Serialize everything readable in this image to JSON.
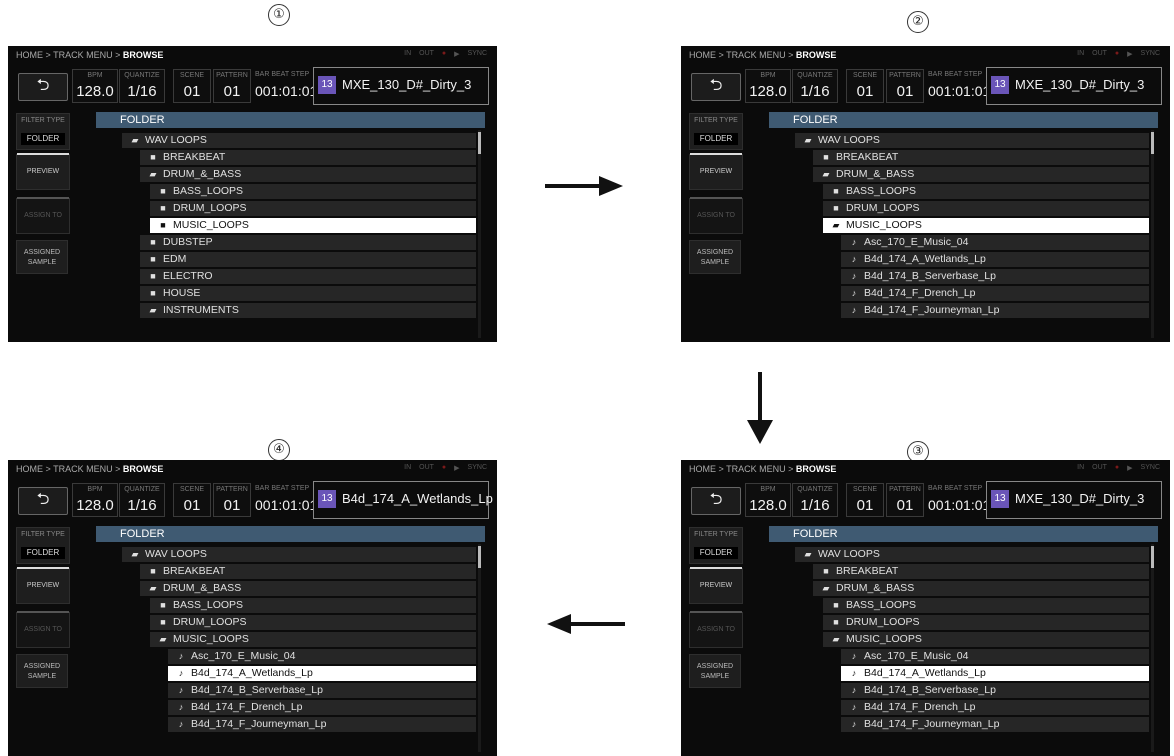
{
  "steps": {
    "s1": "①",
    "s2": "②",
    "s3": "③",
    "s4": "④"
  },
  "colors": {
    "folder_header": "#3f5a72",
    "track_num_bg": "#6a55b8",
    "screen_bg": "#0b0b0b",
    "selected_row": "#ffffff"
  },
  "screens": [
    {
      "breadcrumb": {
        "path": "HOME > TRACK MENU > ",
        "current": "BROWSE"
      },
      "status": {
        "in": "IN",
        "out": "OUT",
        "rec": "●",
        "play": "▶",
        "sync": "SYNC"
      },
      "back_icon": "⮌",
      "params": {
        "bpm_label": "BPM",
        "bpm": "128.0",
        "quantize_label": "QUANTIZE",
        "quantize": "1/16",
        "scene_label": "SCENE",
        "scene": "01",
        "pattern_label": "PATTERN",
        "pattern": "01",
        "barbeat_label": "BAR BEAT STEP",
        "barbeat": "001:01:01"
      },
      "track": {
        "num": "13",
        "name": "MXE_130_D#_Dirty_3"
      },
      "side": {
        "filter_label": "FILTER TYPE",
        "filter_value": "FOLDER",
        "preview": "PREVIEW",
        "assign": "ASSIGN TO",
        "assigned_1": "ASSIGNED",
        "assigned_2": "SAMPLE"
      },
      "header": "FOLDER",
      "rows": [
        {
          "label": "WAV LOOPS",
          "icon": "open-folder"
        },
        {
          "label": "BREAKBEAT",
          "icon": "folder"
        },
        {
          "label": "DRUM_&_BASS",
          "icon": "open-folder"
        },
        {
          "label": "BASS_LOOPS",
          "icon": "folder"
        },
        {
          "label": "DRUM_LOOPS",
          "icon": "folder"
        },
        {
          "label": "MUSIC_LOOPS",
          "icon": "folder",
          "selected": true
        },
        {
          "label": "DUBSTEP",
          "icon": "folder"
        },
        {
          "label": "EDM",
          "icon": "folder"
        },
        {
          "label": "ELECTRO",
          "icon": "folder"
        },
        {
          "label": "HOUSE",
          "icon": "folder"
        },
        {
          "label": "INSTRUMENTS",
          "icon": "open-folder"
        }
      ]
    },
    {
      "breadcrumb": {
        "path": "HOME > TRACK MENU > ",
        "current": "BROWSE"
      },
      "status": {
        "in": "IN",
        "out": "OUT",
        "rec": "●",
        "play": "▶",
        "sync": "SYNC"
      },
      "back_icon": "⮌",
      "params": {
        "bpm_label": "BPM",
        "bpm": "128.0",
        "quantize_label": "QUANTIZE",
        "quantize": "1/16",
        "scene_label": "SCENE",
        "scene": "01",
        "pattern_label": "PATTERN",
        "pattern": "01",
        "barbeat_label": "BAR BEAT STEP",
        "barbeat": "001:01:01"
      },
      "track": {
        "num": "13",
        "name": "MXE_130_D#_Dirty_3"
      },
      "side": {
        "filter_label": "FILTER TYPE",
        "filter_value": "FOLDER",
        "preview": "PREVIEW",
        "assign": "ASSIGN TO",
        "assigned_1": "ASSIGNED",
        "assigned_2": "SAMPLE"
      },
      "header": "FOLDER",
      "rows": [
        {
          "label": "WAV LOOPS",
          "icon": "open-folder"
        },
        {
          "label": "BREAKBEAT",
          "icon": "folder"
        },
        {
          "label": "DRUM_&_BASS",
          "icon": "open-folder"
        },
        {
          "label": "BASS_LOOPS",
          "icon": "folder"
        },
        {
          "label": "DRUM_LOOPS",
          "icon": "folder"
        },
        {
          "label": "MUSIC_LOOPS",
          "icon": "open-folder",
          "selected": true
        },
        {
          "label": "Asc_170_E_Music_04",
          "icon": "note"
        },
        {
          "label": "B4d_174_A_Wetlands_Lp",
          "icon": "note"
        },
        {
          "label": "B4d_174_B_Serverbase_Lp",
          "icon": "note"
        },
        {
          "label": "B4d_174_F_Drench_Lp",
          "icon": "note"
        },
        {
          "label": "B4d_174_F_Journeyman_Lp",
          "icon": "note"
        }
      ]
    },
    {
      "breadcrumb": {
        "path": "HOME > TRACK MENU > ",
        "current": "BROWSE"
      },
      "status": {
        "in": "IN",
        "out": "OUT",
        "rec": "●",
        "play": "▶",
        "sync": "SYNC"
      },
      "back_icon": "⮌",
      "params": {
        "bpm_label": "BPM",
        "bpm": "128.0",
        "quantize_label": "QUANTIZE",
        "quantize": "1/16",
        "scene_label": "SCENE",
        "scene": "01",
        "pattern_label": "PATTERN",
        "pattern": "01",
        "barbeat_label": "BAR BEAT STEP",
        "barbeat": "001:01:01"
      },
      "track": {
        "num": "13",
        "name": "MXE_130_D#_Dirty_3"
      },
      "side": {
        "filter_label": "FILTER TYPE",
        "filter_value": "FOLDER",
        "preview": "PREVIEW",
        "assign": "ASSIGN TO",
        "assigned_1": "ASSIGNED",
        "assigned_2": "SAMPLE"
      },
      "header": "FOLDER",
      "rows": [
        {
          "label": "WAV LOOPS",
          "icon": "open-folder"
        },
        {
          "label": "BREAKBEAT",
          "icon": "folder"
        },
        {
          "label": "DRUM_&_BASS",
          "icon": "open-folder"
        },
        {
          "label": "BASS_LOOPS",
          "icon": "folder"
        },
        {
          "label": "DRUM_LOOPS",
          "icon": "folder"
        },
        {
          "label": "MUSIC_LOOPS",
          "icon": "open-folder"
        },
        {
          "label": "Asc_170_E_Music_04",
          "icon": "note"
        },
        {
          "label": "B4d_174_A_Wetlands_Lp",
          "icon": "note",
          "selected": true
        },
        {
          "label": "B4d_174_B_Serverbase_Lp",
          "icon": "note"
        },
        {
          "label": "B4d_174_F_Drench_Lp",
          "icon": "note"
        },
        {
          "label": "B4d_174_F_Journeyman_Lp",
          "icon": "note"
        }
      ]
    },
    {
      "breadcrumb": {
        "path": "HOME > TRACK MENU > ",
        "current": "BROWSE"
      },
      "status": {
        "in": "IN",
        "out": "OUT",
        "rec": "●",
        "play": "▶",
        "sync": "SYNC"
      },
      "back_icon": "⮌",
      "params": {
        "bpm_label": "BPM",
        "bpm": "128.0",
        "quantize_label": "QUANTIZE",
        "quantize": "1/16",
        "scene_label": "SCENE",
        "scene": "01",
        "pattern_label": "PATTERN",
        "pattern": "01",
        "barbeat_label": "BAR BEAT STEP",
        "barbeat": "001:01:01"
      },
      "track": {
        "num": "13",
        "name": "B4d_174_A_Wetlands_Lp"
      },
      "side": {
        "filter_label": "FILTER TYPE",
        "filter_value": "FOLDER",
        "preview": "PREVIEW",
        "assign": "ASSIGN TO",
        "assigned_1": "ASSIGNED",
        "assigned_2": "SAMPLE"
      },
      "header": "FOLDER",
      "rows": [
        {
          "label": "WAV LOOPS",
          "icon": "open-folder"
        },
        {
          "label": "BREAKBEAT",
          "icon": "folder"
        },
        {
          "label": "DRUM_&_BASS",
          "icon": "open-folder"
        },
        {
          "label": "BASS_LOOPS",
          "icon": "folder"
        },
        {
          "label": "DRUM_LOOPS",
          "icon": "folder"
        },
        {
          "label": "MUSIC_LOOPS",
          "icon": "open-folder"
        },
        {
          "label": "Asc_170_E_Music_04",
          "icon": "note"
        },
        {
          "label": "B4d_174_A_Wetlands_Lp",
          "icon": "note",
          "selected": true
        },
        {
          "label": "B4d_174_B_Serverbase_Lp",
          "icon": "note"
        },
        {
          "label": "B4d_174_F_Drench_Lp",
          "icon": "note"
        },
        {
          "label": "B4d_174_F_Journeyman_Lp",
          "icon": "note"
        }
      ]
    }
  ]
}
